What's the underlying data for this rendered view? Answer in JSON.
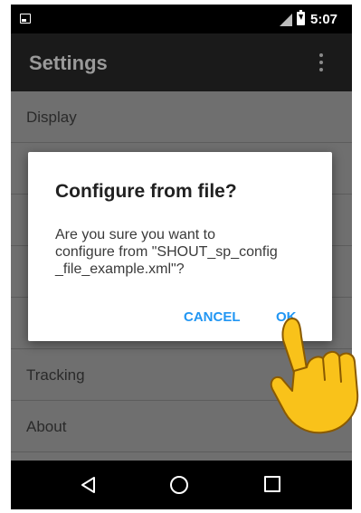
{
  "status_bar": {
    "time": "5:07",
    "icons": [
      "notification-icon",
      "signal-icon",
      "battery-charging-icon"
    ]
  },
  "toolbar": {
    "title": "Settings",
    "overflow_icon": "more-vert-icon"
  },
  "settings_list": {
    "items": [
      {
        "label": "Display"
      },
      {
        "label": ""
      },
      {
        "label": ""
      },
      {
        "label": ""
      },
      {
        "label": ""
      },
      {
        "label": "Tracking"
      },
      {
        "label": "About"
      }
    ]
  },
  "dialog": {
    "title": "Configure from file?",
    "message_lines": [
      "Are you sure you want to",
      "configure from \"SHOUT_sp_config",
      "_file_example.xml\"?"
    ],
    "cancel_label": "CANCEL",
    "ok_label": "OK"
  },
  "nav_bar": {
    "icons": [
      "back-icon",
      "home-icon",
      "recents-icon"
    ]
  },
  "overlay": {
    "icon": "pointing-hand-icon"
  },
  "colors": {
    "accent": "#2196f3",
    "scrim": "#6f6f6f",
    "hand": "#f9c21a"
  }
}
